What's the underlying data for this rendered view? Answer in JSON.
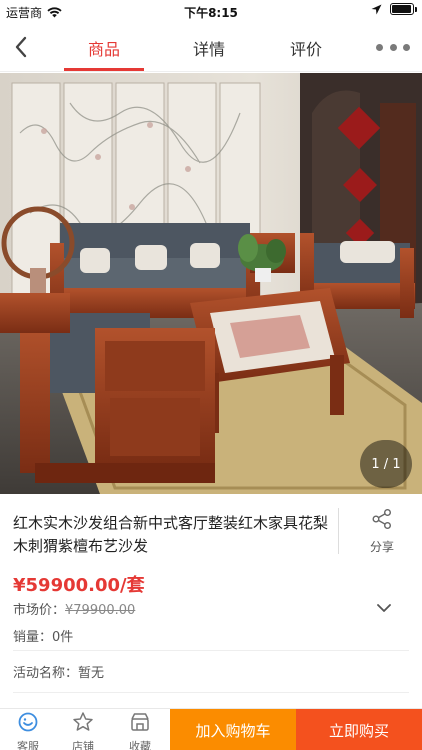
{
  "status_bar": {
    "carrier": "运营商",
    "time": "下午8:15",
    "battery_level": 0.95
  },
  "nav": {
    "tabs": [
      {
        "label": "商品",
        "active": true
      },
      {
        "label": "详情",
        "active": false
      },
      {
        "label": "评价",
        "active": false
      }
    ],
    "icons": {
      "back": "chevron-left-icon",
      "more": "more-dots-icon"
    }
  },
  "gallery": {
    "counter": "1 / 1"
  },
  "product": {
    "title": "红木实木沙发组合新中式客厅整装红木家具花梨木刺猬紫檀布艺沙发",
    "share_label": "分享",
    "price": "¥59900.00/套",
    "market_label": "市场价：",
    "market_price": "¥79900.00",
    "sales_label": "销量：",
    "sales_value": "0件",
    "promo_label": "活动名称：",
    "promo_value": "暂无"
  },
  "bottom_bar": {
    "service_label": "客服",
    "store_label": "店铺",
    "favorite_label": "收藏",
    "cart_label": "加入购物车",
    "buy_label": "立即购买"
  },
  "colors": {
    "accent": "#e53935",
    "cart_button": "#fb8c00",
    "buy_button": "#f4511e"
  }
}
